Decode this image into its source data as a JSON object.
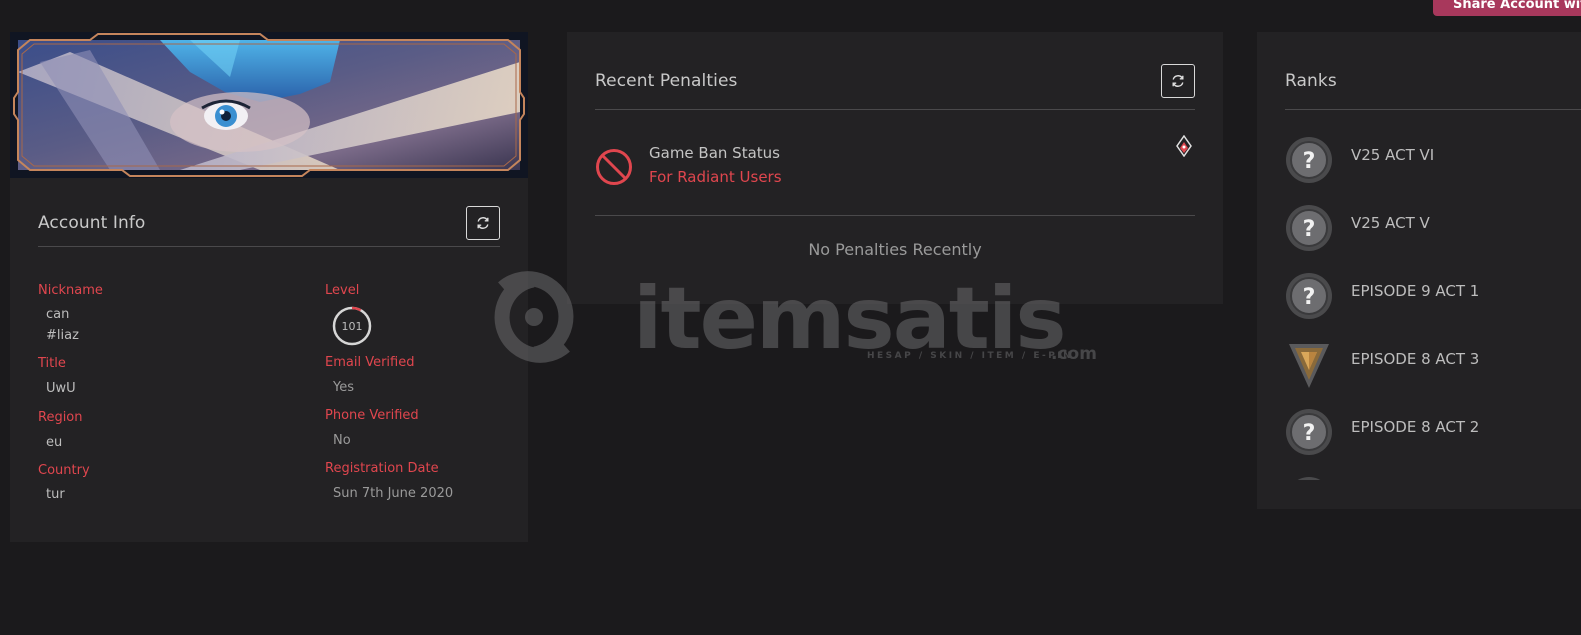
{
  "header": {
    "share_label": "Share Account with"
  },
  "account": {
    "title": "Account Info",
    "fields": {
      "nickname_label": "Nickname",
      "nickname_name": "can",
      "nickname_tag": "#liaz",
      "title_label": "Title",
      "title_value": "UwU",
      "region_label": "Region",
      "region_value": "eu",
      "country_label": "Country",
      "country_value": "tur",
      "level_label": "Level",
      "level_value": "101",
      "level_progress": 0.08,
      "email_label": "Email Verified",
      "email_value": "Yes",
      "phone_label": "Phone Verified",
      "phone_value": "No",
      "registration_label": "Registration Date",
      "registration_value": "Sun 7th June 2020"
    }
  },
  "penalties": {
    "title": "Recent Penalties",
    "ban_title": "Game Ban Status",
    "ban_status": "For Radiant Users",
    "empty_text": "No Penalties Recently"
  },
  "ranks": {
    "title": "Ranks",
    "items": [
      {
        "label": "V25 ACT VI",
        "icon": "unranked-icon"
      },
      {
        "label": "V25 ACT V",
        "icon": "unranked-icon"
      },
      {
        "label": "EPISODE 9 ACT 1",
        "icon": "unranked-icon"
      },
      {
        "label": "EPISODE 8 ACT 3",
        "icon": "bronze-rank-icon"
      },
      {
        "label": "EPISODE 8 ACT 2",
        "icon": "unranked-icon"
      }
    ]
  },
  "watermark": {
    "brand": "itemsatis",
    "tagline": "HESAP / SKIN / ITEM / E-PIN",
    "suffix": ".com"
  },
  "colors": {
    "background": "#1b1a1c",
    "card": "#232224",
    "accent_red": "#e0464e",
    "share_button": "#a8385c"
  }
}
